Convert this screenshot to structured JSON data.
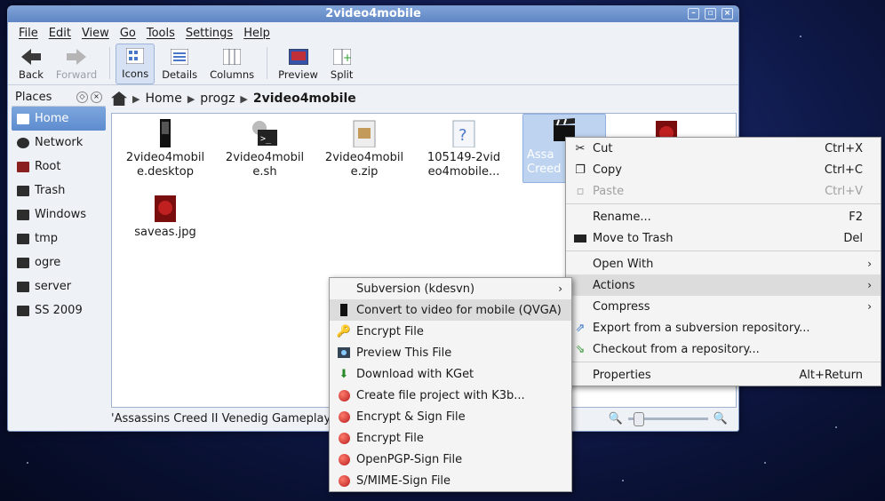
{
  "window": {
    "title": "2video4mobile"
  },
  "menubar": [
    "File",
    "Edit",
    "View",
    "Go",
    "Tools",
    "Settings",
    "Help"
  ],
  "toolbar": {
    "back": "Back",
    "forward": "Forward",
    "icons": "Icons",
    "details": "Details",
    "columns": "Columns",
    "preview": "Preview",
    "split": "Split"
  },
  "places": {
    "title": "Places",
    "items": [
      "Home",
      "Network",
      "Root",
      "Trash",
      "Windows",
      "tmp",
      "ogre",
      "server",
      "SS 2009"
    ]
  },
  "breadcrumb": {
    "items": [
      "Home",
      "progz",
      "2video4mobile"
    ]
  },
  "files": [
    {
      "name": "2video4mobil\ne.desktop"
    },
    {
      "name": "2video4mobil\ne.sh"
    },
    {
      "name": "2video4mobil\ne.zip"
    },
    {
      "name": "105149-2vid\neo4mobile..."
    },
    {
      "name": "Assa\nCreed"
    },
    {
      "name": ""
    },
    {
      "name": "saveas.jpg"
    }
  ],
  "status": {
    "text": "'Assassins Creed II Venedig Gameplay"
  },
  "context_menu": {
    "cut": "Cut",
    "cut_sc": "Ctrl+X",
    "copy": "Copy",
    "copy_sc": "Ctrl+C",
    "paste": "Paste",
    "paste_sc": "Ctrl+V",
    "rename": "Rename...",
    "rename_sc": "F2",
    "trash": "Move to Trash",
    "trash_sc": "Del",
    "open_with": "Open With",
    "actions": "Actions",
    "compress": "Compress",
    "export": "Export from a subversion repository...",
    "checkout": "Checkout from a repository...",
    "properties": "Properties",
    "properties_sc": "Alt+Return"
  },
  "actions_menu": {
    "subversion": "Subversion (kdesvn)",
    "convert": "Convert to video for mobile (QVGA)",
    "encrypt1": "Encrypt File",
    "preview": "Preview This File",
    "download": "Download with KGet",
    "k3b": "Create file project with K3b...",
    "encrypt_sign": "Encrypt & Sign File",
    "encrypt2": "Encrypt File",
    "openpgp": "OpenPGP-Sign File",
    "smime": "S/MIME-Sign File"
  }
}
